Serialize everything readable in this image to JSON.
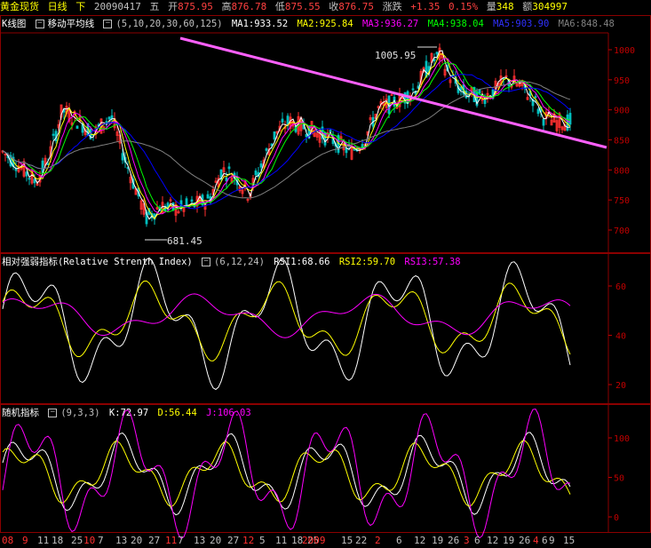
{
  "infobar": {
    "name": "黄金现货",
    "period": "日线",
    "direction": "下",
    "date": "20090417",
    "weekday": "五",
    "open_label": "开",
    "open": "875.95",
    "high_label": "高",
    "high": "876.78",
    "low_label": "低",
    "low": "875.55",
    "close_label": "收",
    "close": "876.75",
    "change_label": "涨跌",
    "change": "+1.35",
    "change_pct": "0.15%",
    "vol_label": "量",
    "vol": "348",
    "amt_label": "额",
    "amt": "304997"
  },
  "main_panel": {
    "title": "K线图",
    "indicator": "移动平均线",
    "params": "(5,10,20,30,60,125)",
    "ma": [
      {
        "label": "MA1:933.52",
        "color": "#ffffff"
      },
      {
        "label": "MA2:925.84",
        "color": "#ffff00"
      },
      {
        "label": "MA3:936.27",
        "color": "#ff00ff"
      },
      {
        "label": "MA4:938.04",
        "color": "#00ff00"
      },
      {
        "label": "MA5:903.90",
        "color": "#0000ff"
      },
      {
        "label": "MA6:848.48",
        "color": "#808080"
      }
    ],
    "y_ticks": [
      "1000",
      "950",
      "900",
      "850",
      "800",
      "750",
      "700"
    ],
    "high_mark": "1005.95",
    "low_mark": "681.45"
  },
  "rsi_panel": {
    "title": "相对强弱指标(Relative Strenth Index)",
    "params": "(6,12,24)",
    "values": [
      {
        "label": "RSI1:68.66",
        "color": "#ffffff"
      },
      {
        "label": "RSI2:59.70",
        "color": "#ffff00"
      },
      {
        "label": "RSI3:57.38",
        "color": "#ff00ff"
      }
    ],
    "y_ticks": [
      "60",
      "40",
      "20"
    ]
  },
  "kdj_panel": {
    "title": "随机指标",
    "params": "(9,3,3)",
    "values": [
      {
        "label": "K:72.97",
        "color": "#ffffff"
      },
      {
        "label": "D:56.44",
        "color": "#ffff00"
      },
      {
        "label": "J:106.03",
        "color": "#ff00ff"
      }
    ],
    "y_ticks": [
      "100",
      "50",
      "0"
    ]
  },
  "x_axis": {
    "labels": [
      {
        "t": "08",
        "red": true
      },
      {
        "t": "9",
        "red": true
      },
      {
        "t": "11",
        "red": false
      },
      {
        "t": "18",
        "red": false
      },
      {
        "t": "25",
        "red": false
      },
      {
        "t": "10",
        "red": true
      },
      {
        "t": "7",
        "red": false
      },
      {
        "t": "13",
        "red": false
      },
      {
        "t": "20",
        "red": false
      },
      {
        "t": "27",
        "red": false
      },
      {
        "t": "11",
        "red": true
      },
      {
        "t": "7",
        "red": false
      },
      {
        "t": "13",
        "red": false
      },
      {
        "t": "20",
        "red": false
      },
      {
        "t": "27",
        "red": false
      },
      {
        "t": "12",
        "red": true
      },
      {
        "t": "5",
        "red": false
      },
      {
        "t": "11",
        "red": false
      },
      {
        "t": "18",
        "red": false
      },
      {
        "t": "25",
        "red": false
      },
      {
        "t": "2009",
        "red": true
      },
      {
        "t": "15",
        "red": false
      },
      {
        "t": "22",
        "red": false
      },
      {
        "t": "2",
        "red": true
      },
      {
        "t": "6",
        "red": false
      },
      {
        "t": "12",
        "red": false
      },
      {
        "t": "19",
        "red": false
      },
      {
        "t": "26",
        "red": false
      },
      {
        "t": "3",
        "red": true
      },
      {
        "t": "6",
        "red": false
      },
      {
        "t": "12",
        "red": false
      },
      {
        "t": "19",
        "red": false
      },
      {
        "t": "26",
        "red": false
      },
      {
        "t": "4",
        "red": true
      },
      {
        "t": "6",
        "red": false
      },
      {
        "t": "9",
        "red": false
      },
      {
        "t": "15",
        "red": false
      }
    ]
  }
}
